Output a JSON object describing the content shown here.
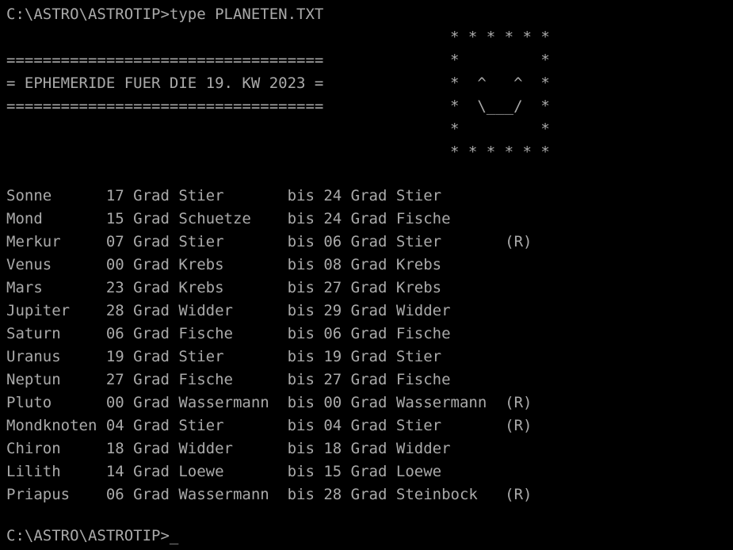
{
  "terminal": {
    "background_color": "#000000",
    "text_color": "#aaaaaa",
    "command_line": "C:\\ASTRO\\ASTROTIP>type PLANETEN.TXT",
    "prompt_line": "C:\\ASTRO\\ASTROTIP>_",
    "prompt": "C:\\ASTRO\\ASTROTIP>",
    "cursor": "_"
  },
  "document": {
    "rule": "===================================",
    "title_line": "= EPHEMERIDE FUER DIE 19. KW 2023 =",
    "title_text": "EPHEMERIDE FUER DIE 19. KW 2023",
    "week": "19. KW",
    "year": "2023"
  },
  "ascii_art": {
    "name": "smiley-face-star-border",
    "lines": [
      "* * * * * *",
      "*         *",
      "*  ^   ^  *",
      "*  \\___/  *",
      "*         *",
      "* * * * * *"
    ]
  },
  "table": {
    "columns": [
      "body",
      "start_degree",
      "unit",
      "start_sign",
      "separator",
      "end_degree",
      "unit",
      "end_sign",
      "retrograde"
    ],
    "unit_label": "Grad",
    "separator_label": "bis",
    "retrograde_label": "(R)",
    "rows": [
      {
        "body": "Sonne",
        "start_degree": "17",
        "start_sign": "Stier",
        "end_degree": "24",
        "end_sign": "Stier",
        "retrograde": ""
      },
      {
        "body": "Mond",
        "start_degree": "15",
        "start_sign": "Schuetze",
        "end_degree": "24",
        "end_sign": "Fische",
        "retrograde": ""
      },
      {
        "body": "Merkur",
        "start_degree": "07",
        "start_sign": "Stier",
        "end_degree": "06",
        "end_sign": "Stier",
        "retrograde": "(R)"
      },
      {
        "body": "Venus",
        "start_degree": "00",
        "start_sign": "Krebs",
        "end_degree": "08",
        "end_sign": "Krebs",
        "retrograde": ""
      },
      {
        "body": "Mars",
        "start_degree": "23",
        "start_sign": "Krebs",
        "end_degree": "27",
        "end_sign": "Krebs",
        "retrograde": ""
      },
      {
        "body": "Jupiter",
        "start_degree": "28",
        "start_sign": "Widder",
        "end_degree": "29",
        "end_sign": "Widder",
        "retrograde": ""
      },
      {
        "body": "Saturn",
        "start_degree": "06",
        "start_sign": "Fische",
        "end_degree": "06",
        "end_sign": "Fische",
        "retrograde": ""
      },
      {
        "body": "Uranus",
        "start_degree": "19",
        "start_sign": "Stier",
        "end_degree": "19",
        "end_sign": "Stier",
        "retrograde": ""
      },
      {
        "body": "Neptun",
        "start_degree": "27",
        "start_sign": "Fische",
        "end_degree": "27",
        "end_sign": "Fische",
        "retrograde": ""
      },
      {
        "body": "Pluto",
        "start_degree": "00",
        "start_sign": "Wassermann",
        "end_degree": "00",
        "end_sign": "Wassermann",
        "retrograde": "(R)"
      },
      {
        "body": "Mondknoten",
        "start_degree": "04",
        "start_sign": "Stier",
        "end_degree": "04",
        "end_sign": "Stier",
        "retrograde": "(R)"
      },
      {
        "body": "Chiron",
        "start_degree": "18",
        "start_sign": "Widder",
        "end_degree": "18",
        "end_sign": "Widder",
        "retrograde": ""
      },
      {
        "body": "Lilith",
        "start_degree": "14",
        "start_sign": "Loewe",
        "end_degree": "15",
        "end_sign": "Loewe",
        "retrograde": ""
      },
      {
        "body": "Priapus",
        "start_degree": "06",
        "start_sign": "Wassermann",
        "end_degree": "28",
        "end_sign": "Steinbock",
        "retrograde": "(R)"
      }
    ]
  }
}
